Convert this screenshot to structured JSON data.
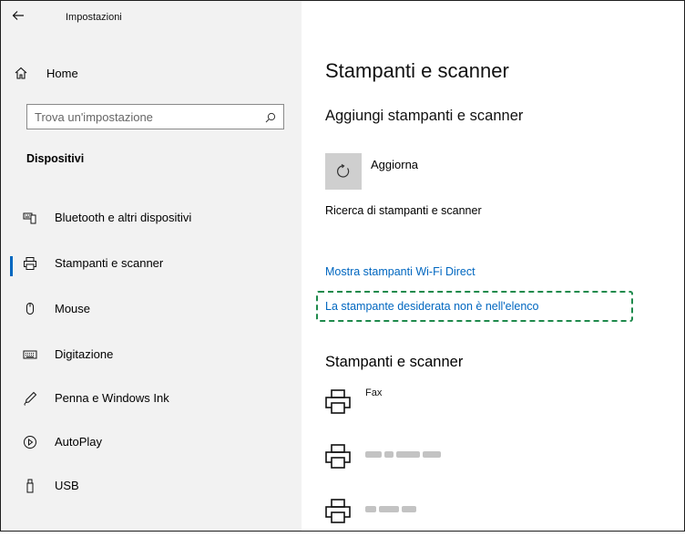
{
  "window": {
    "title": "Impostazioni"
  },
  "sidebar": {
    "home_label": "Home",
    "search_placeholder": "Trova un'impostazione",
    "section_header": "Dispositivi",
    "items": [
      {
        "label": "Bluetooth e altri dispositivi",
        "icon": "bluetooth-devices-icon",
        "selected": false
      },
      {
        "label": "Stampanti e scanner",
        "icon": "printer-icon",
        "selected": true
      },
      {
        "label": "Mouse",
        "icon": "mouse-icon",
        "selected": false
      },
      {
        "label": "Digitazione",
        "icon": "keyboard-icon",
        "selected": false
      },
      {
        "label": "Penna e Windows Ink",
        "icon": "pen-icon",
        "selected": false
      },
      {
        "label": "AutoPlay",
        "icon": "autoplay-icon",
        "selected": false
      },
      {
        "label": "USB",
        "icon": "usb-icon",
        "selected": false
      }
    ]
  },
  "main": {
    "title": "Stampanti e scanner",
    "add_section_title": "Aggiungi stampanti e scanner",
    "refresh_label": "Aggiorna",
    "searching_text": "Ricerca di stampanti e scanner",
    "wifi_direct_link": "Mostra stampanti Wi-Fi Direct",
    "missing_printer_link": "La stampante desiderata non è nell'elenco",
    "printers_section_title": "Stampanti e scanner",
    "printers": [
      {
        "name": "Fax",
        "obscured": false
      },
      {
        "name": "",
        "obscured": true
      },
      {
        "name": "",
        "obscured": true
      }
    ]
  },
  "colors": {
    "accent": "#0067c0",
    "highlight_border": "#1f8a4c",
    "sidebar_bg": "#f2f2f2"
  }
}
